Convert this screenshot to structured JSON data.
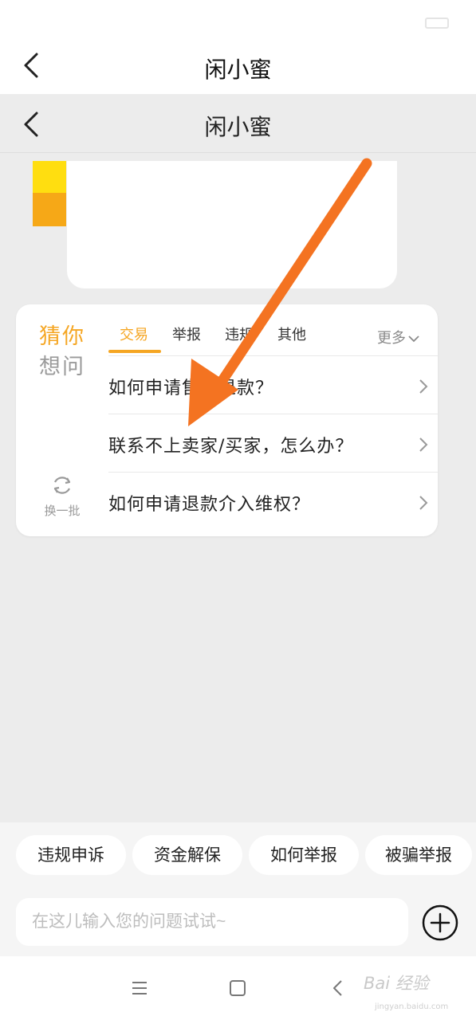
{
  "header": {
    "title": "闲小蜜"
  },
  "overlay_header": {
    "title": "闲小蜜"
  },
  "guess": {
    "title_line1": "猜你",
    "title_line2": "想问",
    "refresh_label": "换一批",
    "tabs": [
      {
        "label": "交易",
        "active": true
      },
      {
        "label": "举报",
        "active": false
      },
      {
        "label": "违规",
        "active": false
      },
      {
        "label": "其他",
        "active": false
      }
    ],
    "more_label": "更多",
    "questions": [
      {
        "text": "如何申请售后退款？"
      },
      {
        "text": "联系不上卖家/买家，怎么办？"
      },
      {
        "text": "如何申请退款介入维权？"
      }
    ]
  },
  "quick_replies": [
    {
      "label": "违规申诉"
    },
    {
      "label": "资金解保"
    },
    {
      "label": "如何举报"
    },
    {
      "label": "被骗举报"
    }
  ],
  "input": {
    "placeholder": "在这儿输入您的问题试试~"
  },
  "watermark": {
    "text": "Bai 经验",
    "url": "jingyan.baidu.com"
  },
  "colors": {
    "accent": "#f5a623",
    "annotation_arrow": "#f47321",
    "avatar_yellow": "#ffde10",
    "avatar_orange": "#f6a817"
  },
  "icons": {
    "back": "chevron-left-icon",
    "refresh": "refresh-icon",
    "more": "chevron-down-icon",
    "row": "chevron-right-icon",
    "add": "plus-circle-icon",
    "menu": "menu-icon",
    "home": "square-icon",
    "sys_back": "back-triangle-icon"
  }
}
